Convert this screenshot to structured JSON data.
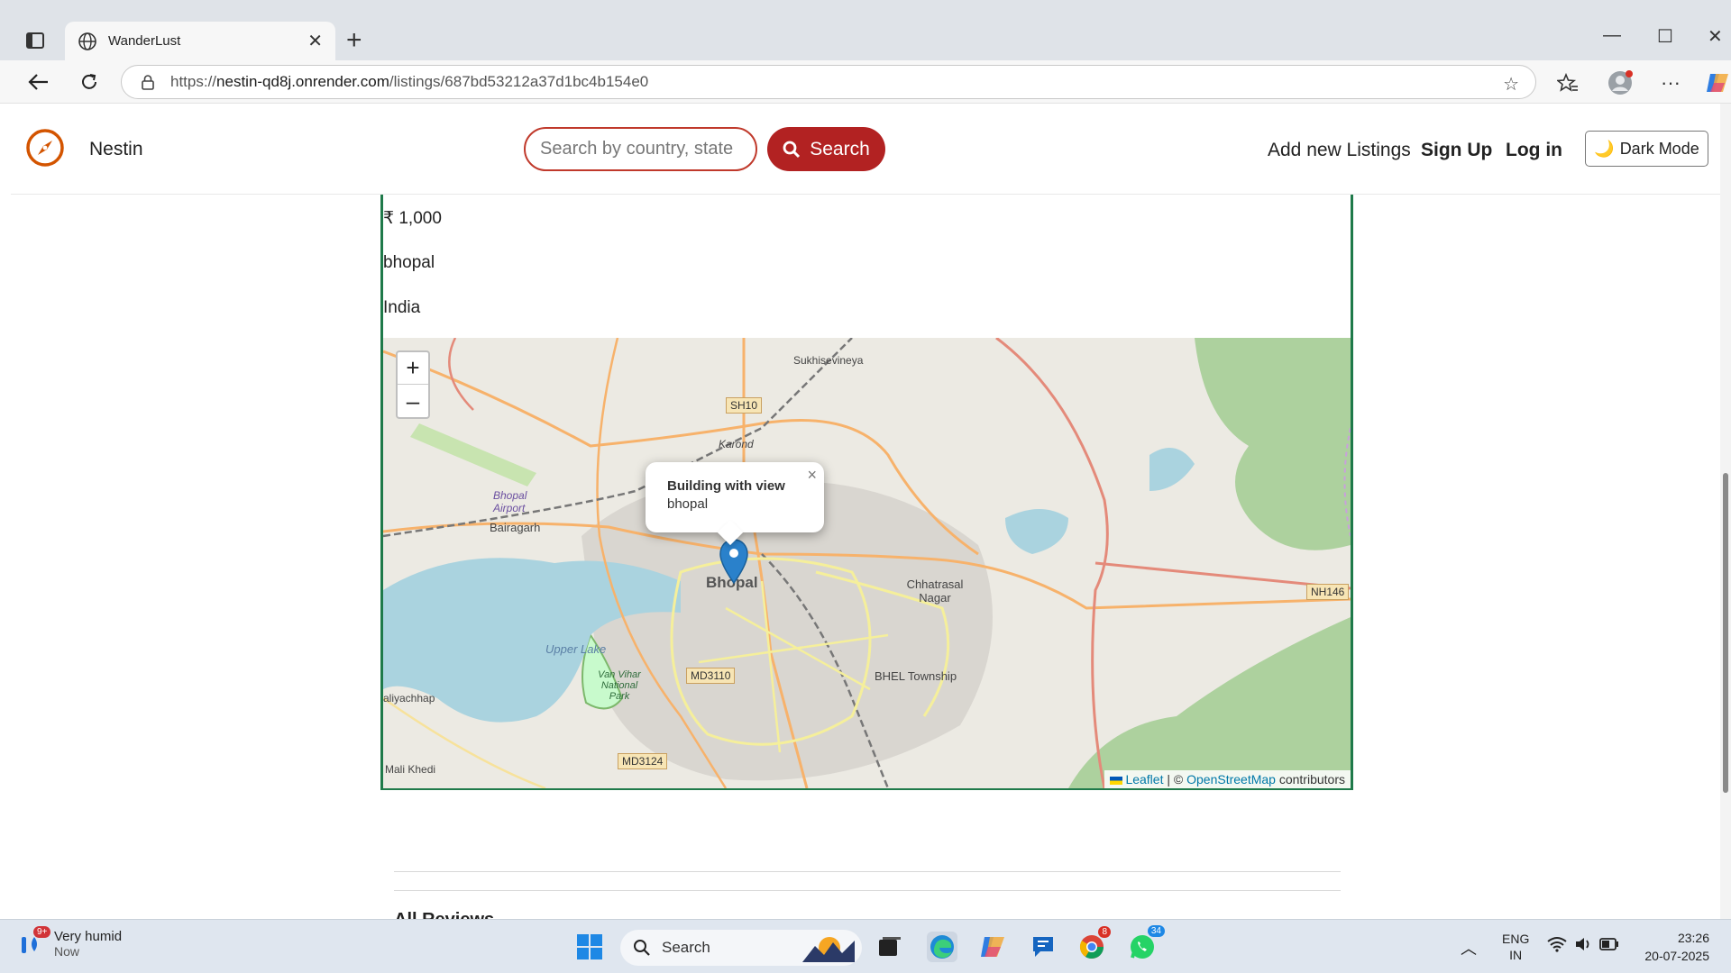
{
  "browser": {
    "tab_title": "WanderLust",
    "url_host": "nestin-qd8j.onrender.com",
    "url_scheme": "https://",
    "url_path": "/listings/687bd53212a37d1bc4b154e0"
  },
  "navbar": {
    "brand": "Nestin",
    "search_placeholder": "Search by country, state",
    "search_label": "Search",
    "add_listing": "Add new Listings",
    "sign_up": "Sign Up",
    "log_in": "Log in",
    "dark_mode": "Dark Mode",
    "accent_color": "#b22222"
  },
  "listing": {
    "price": "₹ 1,000",
    "location": "bhopal",
    "country": "India"
  },
  "map": {
    "zoom_in": "+",
    "zoom_out": "–",
    "popup_title": "Building with view",
    "popup_subtitle": "bhopal",
    "popup_close": "×",
    "attribution_leaflet": "Leaflet",
    "attribution_sep": "| ©",
    "attribution_osm": "OpenStreetMap",
    "attribution_tail": "contributors",
    "labels": {
      "sukhi": "Sukhisevineya",
      "karond": "Karond",
      "airport": "Bhopal Airport",
      "bairagarh": "Bairagarh",
      "bhopal": "Bhopal",
      "chhatrasal": "Chhatrasal Nagar",
      "upper_lake": "Upper Lake",
      "van_vihar": "Van Vihar National Park",
      "bhel": "BHEL Township",
      "aliyachhap": "aliyachhap",
      "mali_khedi": "Mali Khedi"
    },
    "roads": {
      "sh10": "SH10",
      "nh146": "NH146",
      "md3110": "MD3110",
      "md3124": "MD3124"
    }
  },
  "reviews": {
    "heading": "All Reviews"
  },
  "taskbar": {
    "weather_badge": "9+",
    "weather_title": "Very humid",
    "weather_sub": "Now",
    "search_label": "Search",
    "chrome_badge": "8",
    "whatsapp_badge": "34",
    "lang_line1": "ENG",
    "lang_line2": "IN",
    "time": "23:26",
    "date": "20-07-2025"
  }
}
